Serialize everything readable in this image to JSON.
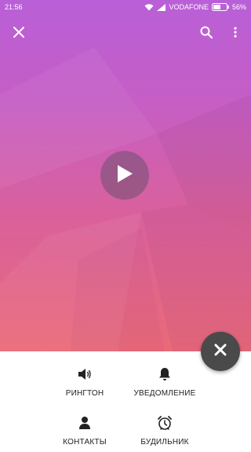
{
  "status_bar": {
    "time": "21:56",
    "carrier": "VODAFONE",
    "battery": "56%",
    "battery_level": 56,
    "icons": [
      "wifi-icon",
      "signal-icon",
      "battery-icon"
    ]
  },
  "toolbar": {
    "icons": [
      "close-icon",
      "search-icon",
      "more-vert-icon"
    ]
  },
  "player": {
    "icon": "play-icon"
  },
  "fab": {
    "icon": "close-icon"
  },
  "options": [
    {
      "label": "РИНГТОН",
      "icon": "speaker-icon"
    },
    {
      "label": "УВЕДОМЛЕНИЕ",
      "icon": "bell-icon"
    },
    {
      "label": "КОНТАКТЫ",
      "icon": "person-icon"
    },
    {
      "label": "БУДИЛЬНИК",
      "icon": "alarm-clock-icon"
    }
  ],
  "colors": {
    "gradient_top": "#b95fd8",
    "gradient_bottom": "#ea6a78",
    "fab": "#4a4a4a",
    "sheet": "#ffffff",
    "label_text": "#222222"
  }
}
